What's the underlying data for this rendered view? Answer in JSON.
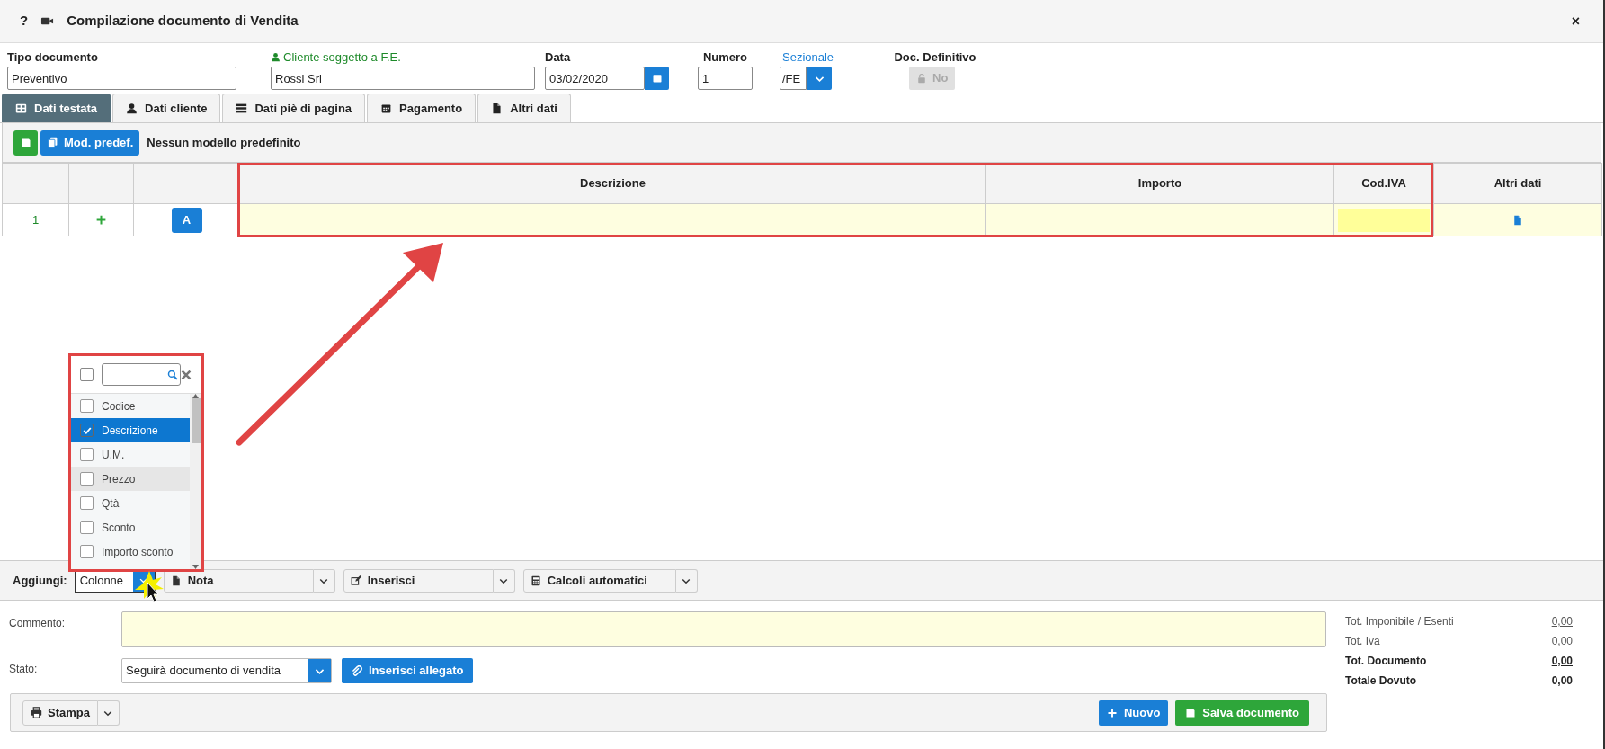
{
  "window": {
    "title": "Compilazione documento di Vendita",
    "help": "?",
    "close": "×"
  },
  "header_fields": [
    {
      "kind": "text",
      "label": "Tipo documento",
      "value": "Preventivo"
    },
    {
      "kind": "client",
      "label": "Cliente soggetto a F.E.",
      "value": "Rossi Srl"
    },
    {
      "kind": "date",
      "label": "Data",
      "value": "03/02/2020"
    },
    {
      "kind": "number",
      "label": "Numero",
      "value": "1"
    },
    {
      "kind": "select",
      "label": "Sezionale",
      "value": "/FE"
    },
    {
      "kind": "toggle",
      "label": "Doc. Definitivo",
      "value": "No",
      "disabled": true
    }
  ],
  "tabs": [
    {
      "label": "Dati testata",
      "selected": true
    },
    {
      "label": "Dati cliente",
      "selected": false
    },
    {
      "label": "Dati piè di pagina",
      "selected": false
    },
    {
      "label": "Pagamento",
      "selected": false
    },
    {
      "label": "Altri dati",
      "selected": false
    }
  ],
  "toolbar": {
    "button": "Mod. predef.",
    "note": "Nessun modello predefinito"
  },
  "table": {
    "columns": [
      "Descrizione",
      "Importo",
      "Cod.IVA",
      "Altri dati"
    ],
    "rows": [
      {
        "number": "1",
        "button": "A"
      }
    ]
  },
  "column_picker": {
    "select_all": false,
    "items": [
      {
        "label": "Codice",
        "checked": false,
        "selected": false,
        "hovered": false
      },
      {
        "label": "Descrizione",
        "checked": true,
        "selected": true,
        "hovered": false
      },
      {
        "label": "U.M.",
        "checked": false,
        "selected": false,
        "hovered": false
      },
      {
        "label": "Prezzo",
        "checked": false,
        "selected": false,
        "hovered": true
      },
      {
        "label": "Qtà",
        "checked": false,
        "selected": false,
        "hovered": false
      },
      {
        "label": "Sconto",
        "checked": false,
        "selected": false,
        "hovered": false
      },
      {
        "label": "Importo sconto",
        "checked": false,
        "selected": false,
        "hovered": false
      }
    ]
  },
  "add_bar": {
    "label": "Aggiungi:",
    "columns_select": "Colonne",
    "dropdowns": [
      "Nota",
      "Inserisci",
      "Calcoli automatici"
    ]
  },
  "comment": {
    "label": "Commento:"
  },
  "status": {
    "label": "Stato:",
    "value": "Seguirà documento di vendita"
  },
  "attach_button": "Inserisci allegato",
  "footer_buttons": {
    "print": "Stampa",
    "new": "Nuovo",
    "save": "Salva documento"
  },
  "totals": [
    {
      "label": "Tot. Imponibile / Esenti",
      "value": "0,00",
      "bold": false,
      "underlined": true
    },
    {
      "label": "Tot. Iva",
      "value": "0,00",
      "bold": false,
      "underlined": true
    },
    {
      "label": "Tot. Documento",
      "value": "0,00",
      "bold": true,
      "underlined": true
    },
    {
      "label": "Totale Dovuto",
      "value": "0,00",
      "bold": true,
      "underlined": false
    }
  ]
}
